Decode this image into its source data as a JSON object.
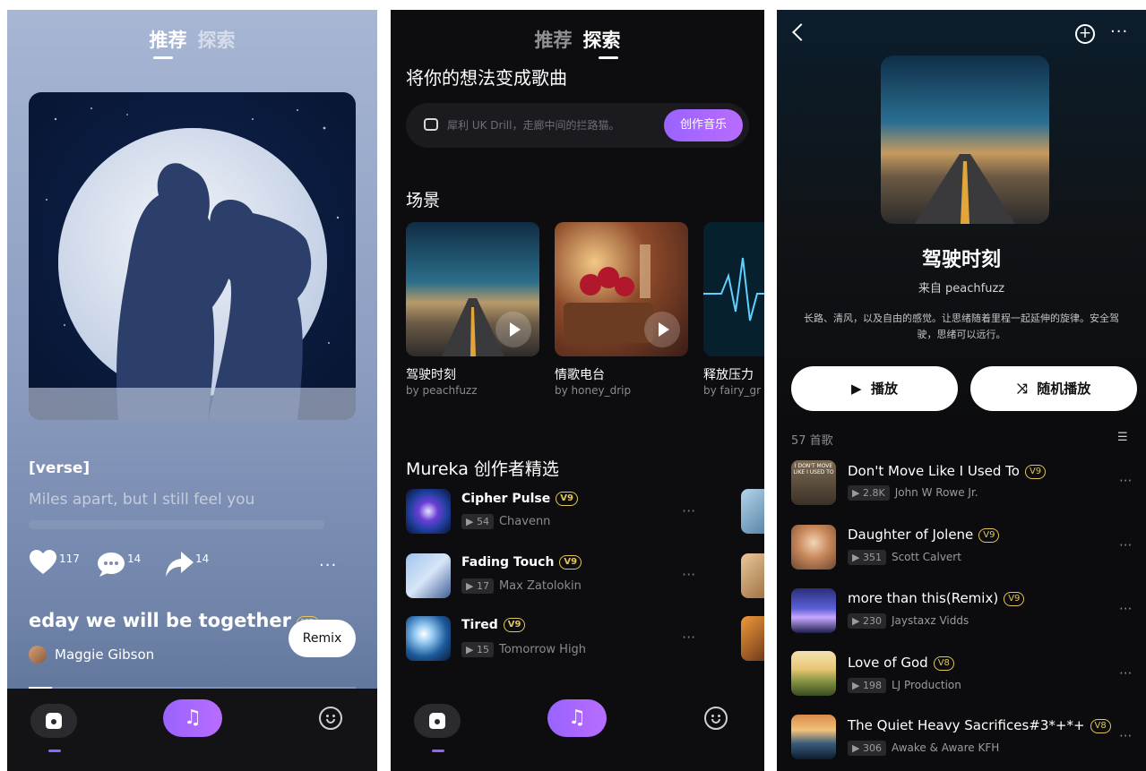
{
  "top_tabs": {
    "recommend": "推荐",
    "explore": "探索"
  },
  "screen1": {
    "lyric_section": "[verse]",
    "lyric_line": "Miles apart, but I still feel you",
    "like_count": "117",
    "comment_count": "14",
    "share_count": "14",
    "song_title": "eday we will be together",
    "version_badge": "V8",
    "artist": "Maggie Gibson",
    "remix_label": "Remix"
  },
  "screen2": {
    "heading": "将你的想法变成歌曲",
    "prompt_placeholder": "犀利 UK Drill，走廊中间的拦路猫。",
    "create_button": "创作音乐",
    "scenes_heading": "场景",
    "scenes": [
      {
        "title": "驾驶时刻",
        "by": "by peachfuzz"
      },
      {
        "title": "情歌电台",
        "by": "by honey_drip"
      },
      {
        "title": "释放压力",
        "by": "by fairy_gr"
      }
    ],
    "creators_heading": "Mureka 创作者精选",
    "creators": [
      {
        "title": "Cipher Pulse",
        "badge": "V9",
        "plays": "54",
        "artist": "Chavenn"
      },
      {
        "title": "Fading Touch",
        "badge": "V9",
        "plays": "17",
        "artist": "Max Zatolokin"
      },
      {
        "title": "Tired",
        "badge": "V9",
        "plays": "15",
        "artist": "Tomorrow High"
      }
    ],
    "more_icon": "···"
  },
  "screen3": {
    "playlist_title": "驾驶时刻",
    "from_label": "来自 peachfuzz",
    "description": "长路、清风，以及自由的感觉。让思绪随着里程一起延伸的旋律。安全驾驶，思绪可以远行。",
    "play_label": "播放",
    "shuffle_label": "随机播放",
    "song_count": "57 首歌",
    "songs": [
      {
        "title": "Don't Move Like I Used To",
        "badge": "V9",
        "plays": "2.8K",
        "artist": "John W Rowe Jr."
      },
      {
        "title": "Daughter of Jolene",
        "badge": "V9",
        "plays": "351",
        "artist": "Scott Calvert"
      },
      {
        "title": "more than this(Remix)",
        "badge": "V9",
        "plays": "230",
        "artist": "Jaystaxz Vidds"
      },
      {
        "title": "Love of God",
        "badge": "V8",
        "plays": "198",
        "artist": "LJ Production"
      },
      {
        "title": "The Quiet Heavy Sacrifices#3*+*+",
        "badge": "V8",
        "plays": "306",
        "artist": "Awake & Aware KFH"
      }
    ],
    "thumb_caption": "I DON'T MOVE LIKE I USED TO",
    "more_icon": "···"
  },
  "colors": {
    "accent": "#a66bff",
    "badge": "#e2c65b",
    "dark_bg": "#0d0d10"
  }
}
